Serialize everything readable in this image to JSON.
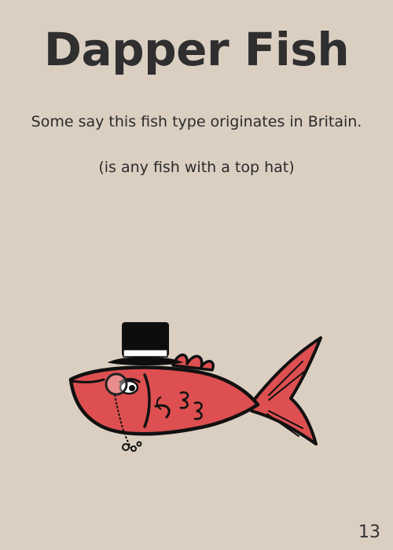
{
  "card": {
    "title": "Dapper Fish",
    "description": "Some say this fish type originates in Britain.",
    "note": "(is any fish with a top hat)",
    "page_number": "13"
  },
  "colors": {
    "background": "#dbcfc2",
    "fish_body": "#dd4f50",
    "outline": "#111111",
    "hat": "#0d0d0d",
    "hat_band": "#ffffff"
  },
  "illustration": {
    "subject": "fish-with-top-hat-and-monocle"
  }
}
